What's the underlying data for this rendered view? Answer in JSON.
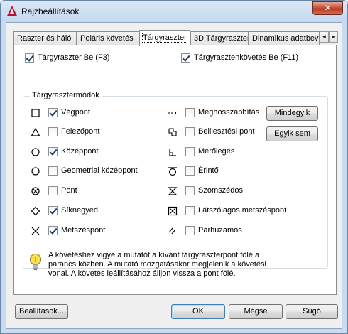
{
  "window": {
    "title": "Rajzbeállítások",
    "close_label": "✕"
  },
  "tabs": [
    {
      "label": "Raszter és háló",
      "active": false
    },
    {
      "label": "Poláris követés",
      "active": false
    },
    {
      "label": "Tárgyraszter",
      "active": true
    },
    {
      "label": "3D Tárgyraszter",
      "active": false
    },
    {
      "label": "Dinamikus adatbevit",
      "active": false
    }
  ],
  "tab_scroll": {
    "left": "◄",
    "right": "►"
  },
  "toggles": {
    "osnap_on": {
      "label": "Tárgyraszter Be (F3)",
      "checked": true
    },
    "tracking_on": {
      "label": "Tárgyrasztenkövetés Be (F11)",
      "checked": true
    }
  },
  "modes_group": {
    "title": "Tárgyrasztermódok"
  },
  "modes_left": [
    {
      "label": "Végpont",
      "checked": true,
      "icon": "square-icon"
    },
    {
      "label": "Felezőpont",
      "checked": false,
      "icon": "triangle-icon"
    },
    {
      "label": "Középpont",
      "checked": true,
      "icon": "circle-icon"
    },
    {
      "label": "Geometriai középpont",
      "checked": false,
      "icon": "circle-dot-icon"
    },
    {
      "label": "Pont",
      "checked": false,
      "icon": "circle-x-icon"
    },
    {
      "label": "Síknegyed",
      "checked": true,
      "icon": "diamond-icon"
    },
    {
      "label": "Metszéspont",
      "checked": true,
      "icon": "x-icon"
    }
  ],
  "modes_right": [
    {
      "label": "Meghosszabbítás",
      "checked": false,
      "icon": "extension-icon"
    },
    {
      "label": "Beillesztési pont",
      "checked": false,
      "icon": "insertion-icon"
    },
    {
      "label": "Merőleges",
      "checked": false,
      "icon": "perpendicular-icon"
    },
    {
      "label": "Érintő",
      "checked": false,
      "icon": "tangent-icon"
    },
    {
      "label": "Szomszédos",
      "checked": false,
      "icon": "hourglass-icon"
    },
    {
      "label": "Látszólagos metszéspont",
      "checked": false,
      "icon": "box-x-icon"
    },
    {
      "label": "Párhuzamos",
      "checked": false,
      "icon": "parallel-icon"
    }
  ],
  "buttons": {
    "select_all": "Mindegyik",
    "clear_all": "Egyik sem",
    "options": "Beállítások...",
    "ok": "OK",
    "cancel": "Mégse",
    "help": "Súgó"
  },
  "info_text": "A követéshez vigye a mutatót a kívánt tárgyraszterpont fölé a parancs közben. A mutató mozgatásakor megjelenik a követési vonal. A követés leállításához álljon vissza a pont fölé.",
  "colors": {
    "checkmark": "#1d3b66",
    "close_button": "#c7523c",
    "window_frame": "#c9dcef"
  }
}
